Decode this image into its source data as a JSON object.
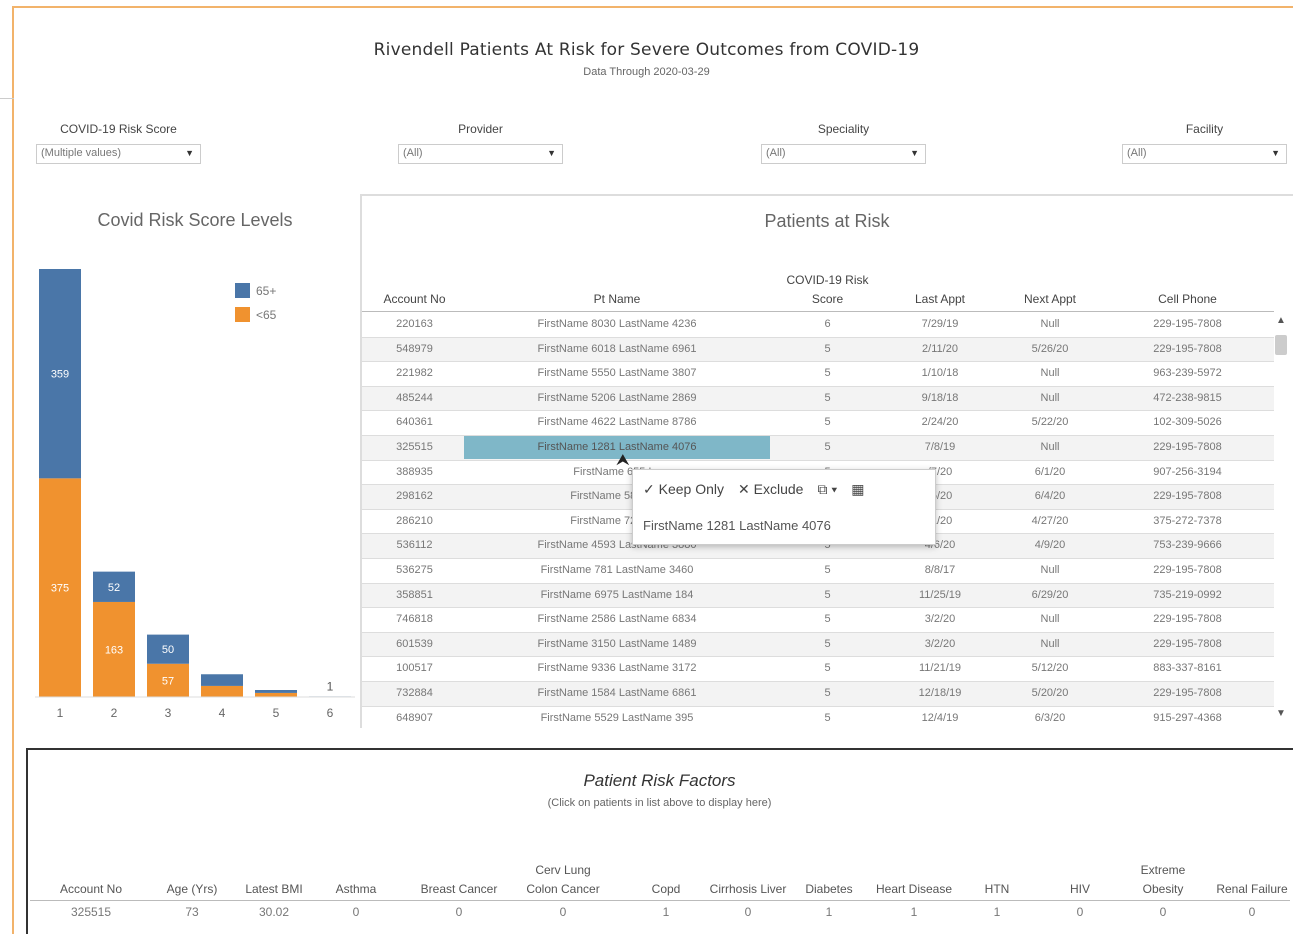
{
  "header": {
    "title": "Rivendell Patients At Risk for Severe Outcomes from COVID-19",
    "subtitle": "Data Through 2020-03-29"
  },
  "filters": [
    {
      "label": "COVID-19 Risk Score",
      "value": "(Multiple values)"
    },
    {
      "label": "Provider",
      "value": "(All)"
    },
    {
      "label": "Speciality",
      "value": "(All)"
    },
    {
      "label": "Facility",
      "value": "(All)"
    }
  ],
  "chart_data": {
    "type": "bar",
    "title": "Covid Risk Score Levels",
    "categories": [
      "1",
      "2",
      "3",
      "4",
      "5",
      "6"
    ],
    "series": [
      {
        "name": "<65",
        "values": [
          375,
          163,
          57,
          19,
          7,
          0
        ],
        "color": "#f0922f"
      },
      {
        "name": "65+",
        "values": [
          359,
          52,
          50,
          20,
          5,
          1
        ],
        "color": "#4a76a8"
      }
    ],
    "totals": [
      null,
      null,
      null,
      null,
      null,
      1
    ],
    "legend_position": "top-right",
    "grid": false
  },
  "table": {
    "title": "Patients at Risk",
    "columns": [
      "Account No",
      "Pt Name",
      "COVID-19 Risk Score",
      "Last Appt",
      "Next Appt",
      "Cell Phone"
    ],
    "rows": [
      [
        "220163",
        "FirstName 8030 LastName 4236",
        "6",
        "7/29/19",
        "Null",
        "229-195-7808"
      ],
      [
        "548979",
        "FirstName 6018 LastName 6961",
        "5",
        "2/11/20",
        "5/26/20",
        "229-195-7808"
      ],
      [
        "221982",
        "FirstName 5550 LastName 3807",
        "5",
        "1/10/18",
        "Null",
        "963-239-5972"
      ],
      [
        "485244",
        "FirstName 5206 LastName 2869",
        "5",
        "9/18/18",
        "Null",
        "472-238-9815"
      ],
      [
        "640361",
        "FirstName 4622 LastName 8786",
        "5",
        "2/24/20",
        "5/22/20",
        "102-309-5026"
      ],
      [
        "325515",
        "FirstName 1281 LastName 4076",
        "5",
        "7/8/19",
        "Null",
        "229-195-7808"
      ],
      [
        "388935",
        "FirstName 655 La",
        "5",
        "/7/20",
        "6/1/20",
        "907-256-3194"
      ],
      [
        "298162",
        "FirstName 5825 La",
        "5",
        "/5/20",
        "6/4/20",
        "229-195-7808"
      ],
      [
        "286210",
        "FirstName 7213 La",
        "5",
        "/1/20",
        "4/27/20",
        "375-272-7378"
      ],
      [
        "536112",
        "FirstName 4593 LastName 3880",
        "5",
        "4/6/20",
        "4/9/20",
        "753-239-9666"
      ],
      [
        "536275",
        "FirstName 781 LastName 3460",
        "5",
        "8/8/17",
        "Null",
        "229-195-7808"
      ],
      [
        "358851",
        "FirstName 6975 LastName 184",
        "5",
        "11/25/19",
        "6/29/20",
        "735-219-0992"
      ],
      [
        "746818",
        "FirstName 2586 LastName 6834",
        "5",
        "3/2/20",
        "Null",
        "229-195-7808"
      ],
      [
        "601539",
        "FirstName 3150 LastName 1489",
        "5",
        "3/2/20",
        "Null",
        "229-195-7808"
      ],
      [
        "100517",
        "FirstName 9336 LastName 3172",
        "5",
        "11/21/19",
        "5/12/20",
        "883-337-8161"
      ],
      [
        "732884",
        "FirstName 1584 LastName 6861",
        "5",
        "12/18/19",
        "5/20/20",
        "229-195-7808"
      ],
      [
        "648907",
        "FirstName 5529 LastName 395",
        "5",
        "12/4/19",
        "6/3/20",
        "915-297-4368"
      ]
    ],
    "selected_row": 5
  },
  "tooltip": {
    "keep_only": "Keep Only",
    "exclude": "Exclude",
    "keep_icon": "✓",
    "exclude_icon": "✕",
    "group_icon": "⧉ ▾",
    "view_icon": "▦",
    "name": "FirstName 1281 LastName 4076"
  },
  "scroll": {
    "up": "▲",
    "down": "▼"
  },
  "risk_factors": {
    "title": "Patient Risk Factors",
    "subtitle": "(Click on patients in list above to display here)",
    "columns": [
      "Account No",
      "Age (Yrs)",
      "Latest BMI",
      "Asthma",
      "Breast Cancer",
      "Cerv Lung Colon Cancer",
      "Copd",
      "Cirrhosis Liver",
      "Diabetes",
      "Heart Disease",
      "HTN",
      "HIV",
      "Extreme Obesity",
      "Renal Failure"
    ],
    "values": [
      "325515",
      "73",
      "30.02",
      "0",
      "0",
      "0",
      "1",
      "0",
      "1",
      "1",
      "1",
      "0",
      "0",
      "0"
    ]
  }
}
